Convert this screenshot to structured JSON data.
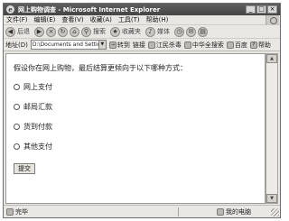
{
  "window": {
    "title": "网上购物调查 - Microsoft Internet Explorer",
    "controls": {
      "minimize": "_",
      "maximize": "□",
      "close": "×"
    }
  },
  "menu": {
    "items": [
      {
        "label": "文件(F)"
      },
      {
        "label": "编辑(E)"
      },
      {
        "label": "查看(V)"
      },
      {
        "label": "收藏(A)"
      },
      {
        "label": "工具(T)"
      },
      {
        "label": "帮助(H)"
      }
    ]
  },
  "toolbar": {
    "back_label": "后退",
    "search_label": "搜索",
    "favorites_label": "收藏夹",
    "media_label": "媒体"
  },
  "address": {
    "label": "地址(D)",
    "value": "D:\\Documents and Settings",
    "go_label": "转到",
    "links_label": "链接",
    "links": [
      {
        "label": "江民杀毒",
        "icon": "antivirus-icon"
      },
      {
        "label": "中华全搜索",
        "icon": "search-site-icon"
      },
      {
        "label": "百度",
        "icon": "baidu-icon"
      },
      {
        "label": "帮助",
        "icon": "help-icon"
      }
    ]
  },
  "page": {
    "question": "假设你在网上购物，最后结算更倾向于以下哪种方式：",
    "options": [
      {
        "label": "网上支付"
      },
      {
        "label": "邮局汇款"
      },
      {
        "label": "货到付款"
      },
      {
        "label": "其他支付"
      }
    ],
    "submit_label": "提交"
  },
  "status": {
    "text": "完毕",
    "zone": "我的电脑"
  }
}
